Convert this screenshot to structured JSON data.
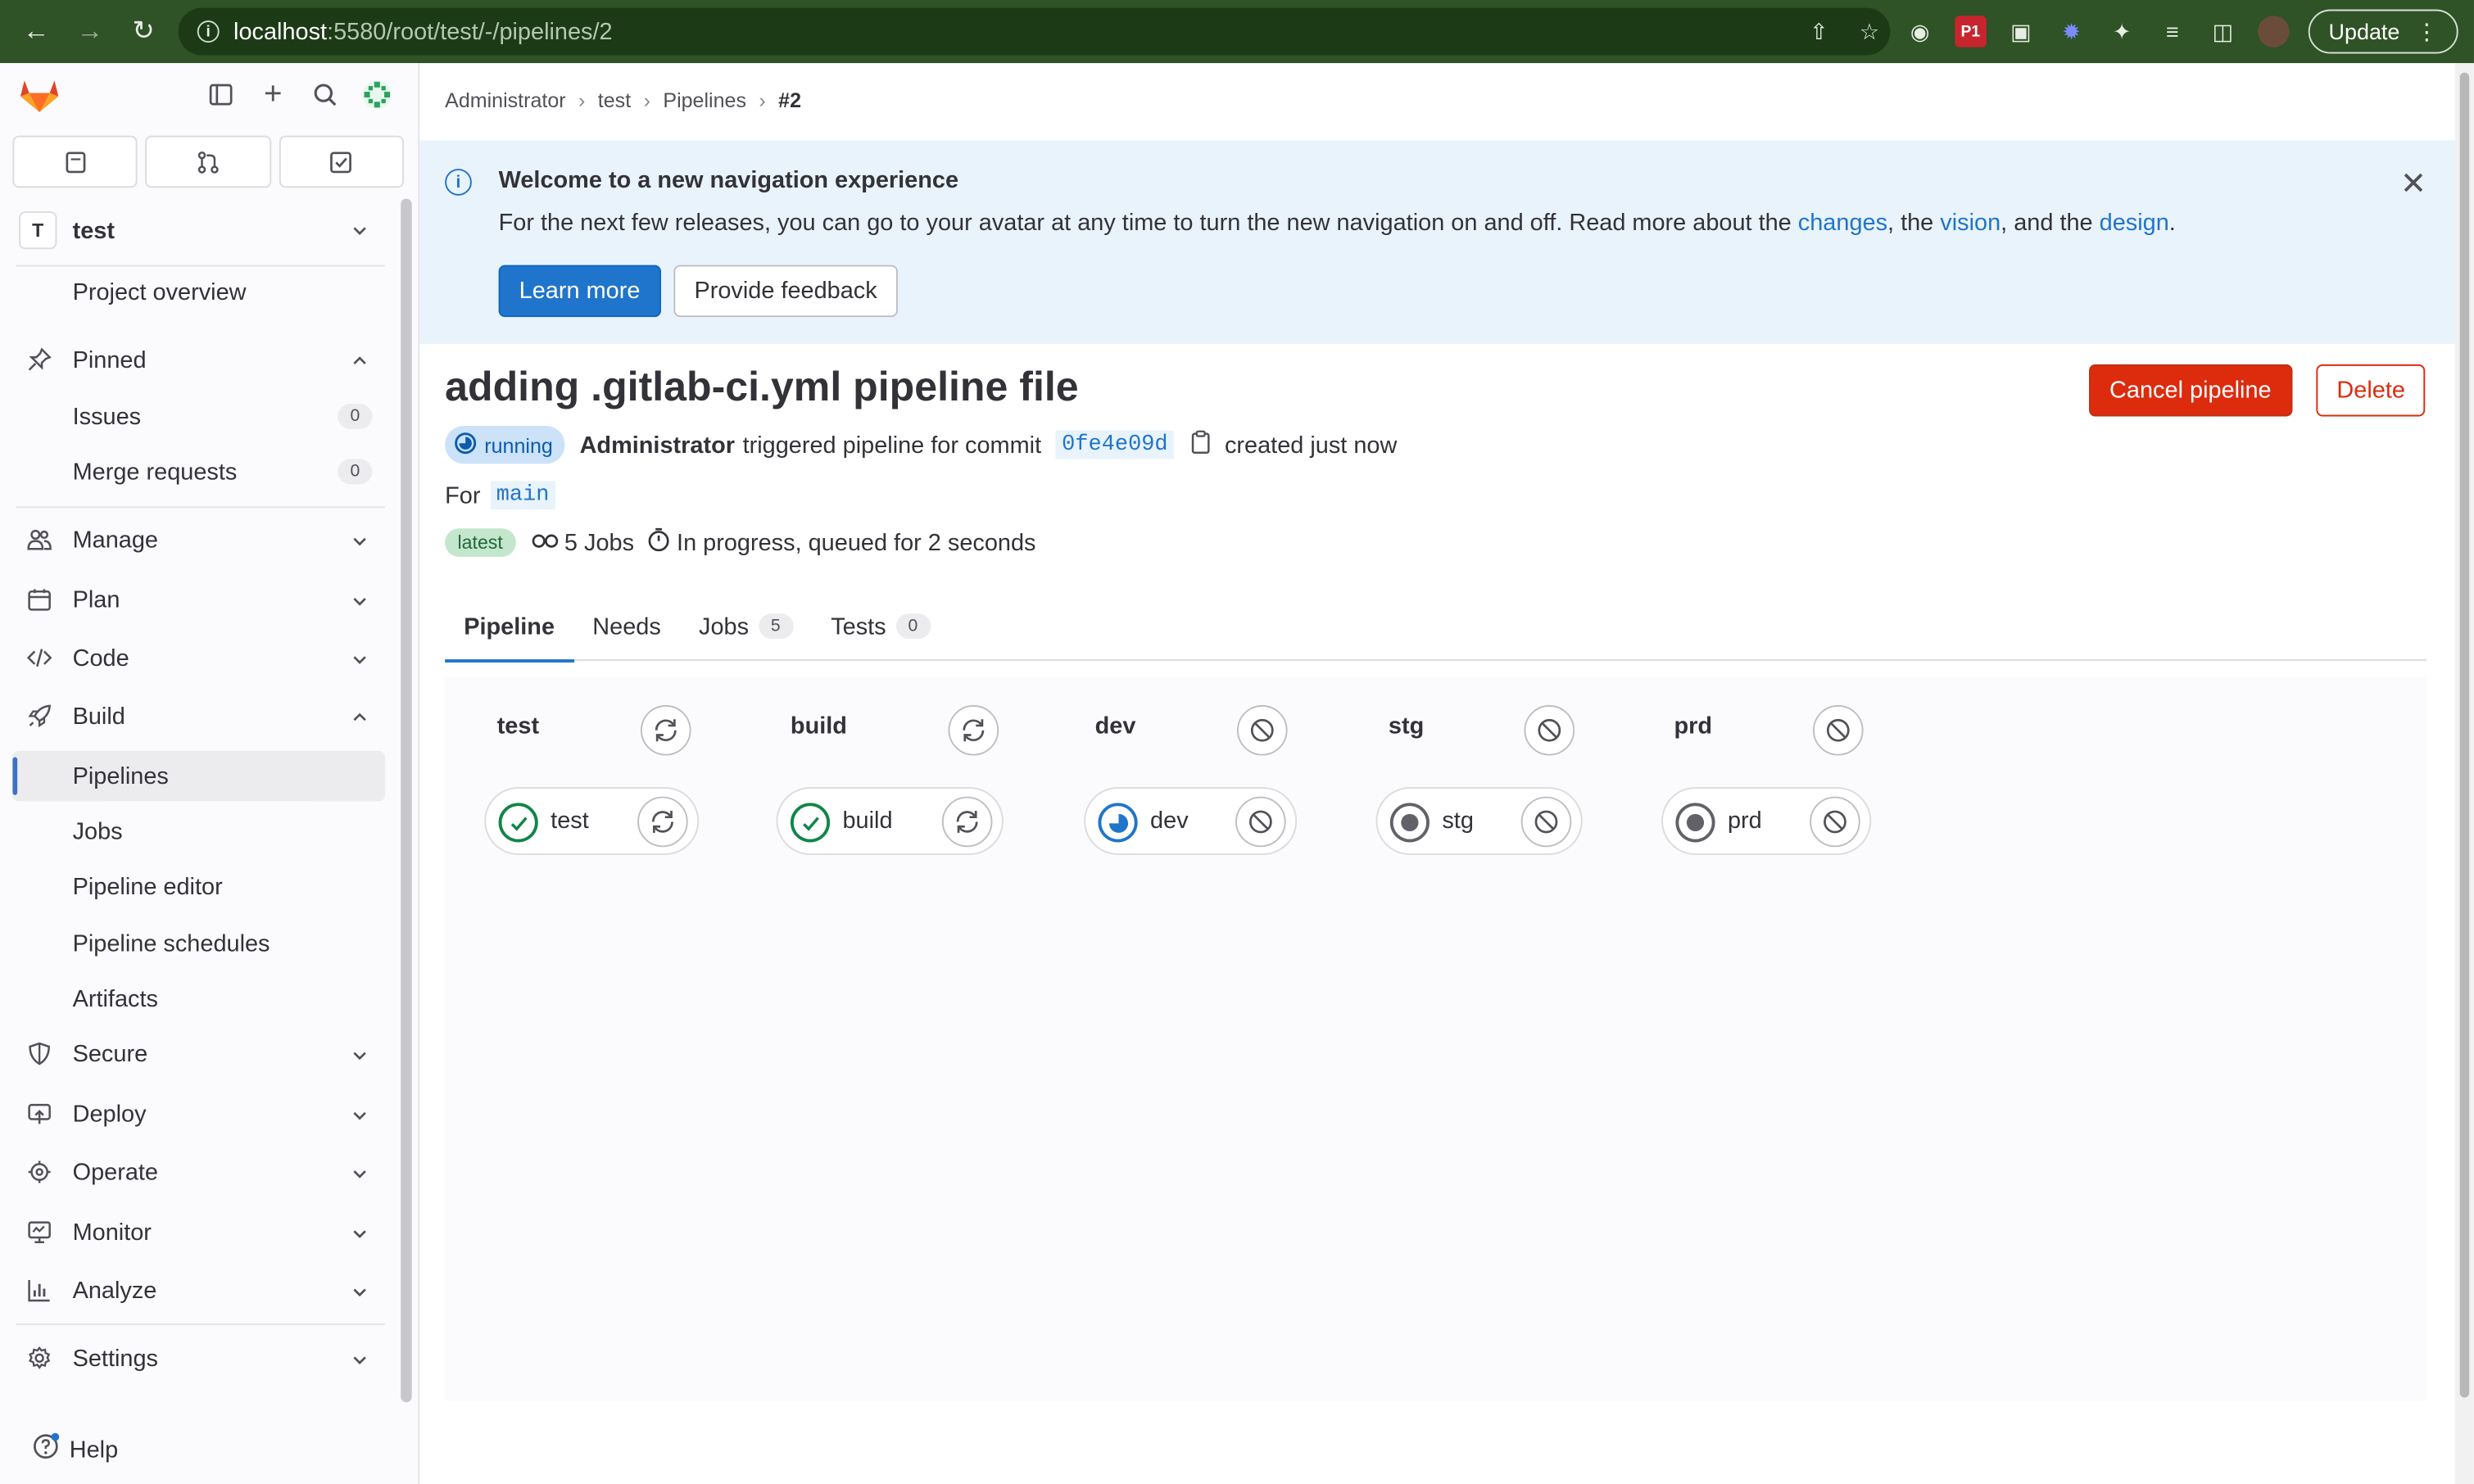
{
  "browser": {
    "url_host": "localhost",
    "url_path": ":5580/root/test/-/pipelines/2",
    "update_label": "Update"
  },
  "sidebar": {
    "project_initial": "T",
    "project_name": "test",
    "items": [
      {
        "label": "Project overview"
      },
      {
        "label": "Pinned"
      },
      {
        "label": "Issues",
        "count": "0"
      },
      {
        "label": "Merge requests",
        "count": "0"
      },
      {
        "label": "Manage"
      },
      {
        "label": "Plan"
      },
      {
        "label": "Code"
      },
      {
        "label": "Build"
      },
      {
        "label": "Pipelines"
      },
      {
        "label": "Jobs"
      },
      {
        "label": "Pipeline editor"
      },
      {
        "label": "Pipeline schedules"
      },
      {
        "label": "Artifacts"
      },
      {
        "label": "Secure"
      },
      {
        "label": "Deploy"
      },
      {
        "label": "Operate"
      },
      {
        "label": "Monitor"
      },
      {
        "label": "Analyze"
      },
      {
        "label": "Settings"
      }
    ],
    "help_label": "Help"
  },
  "breadcrumbs": [
    "Administrator",
    "test",
    "Pipelines",
    "#2"
  ],
  "banner": {
    "title": "Welcome to a new navigation experience",
    "body_prefix": "For the next few releases, you can go to your avatar at any time to turn the new navigation on and off. Read more about the ",
    "link_changes": "changes",
    "sep1": ", the ",
    "link_vision": "vision",
    "sep2": ", and the ",
    "link_design": "design",
    "suffix": ".",
    "learn_more": "Learn more",
    "feedback": "Provide feedback"
  },
  "pipeline": {
    "title": "adding .gitlab-ci.yml pipeline file",
    "cancel_label": "Cancel pipeline",
    "delete_label": "Delete",
    "status": "running",
    "user": "Administrator",
    "triggered_text": "triggered pipeline for commit",
    "sha": "0fe4e09d",
    "created": "created just now",
    "for_label": "For",
    "branch": "main",
    "latest_badge": "latest",
    "jobs_count": "5 Jobs",
    "progress_text": "In progress, queued for 2 seconds"
  },
  "tabs": [
    {
      "label": "Pipeline"
    },
    {
      "label": "Needs"
    },
    {
      "label": "Jobs",
      "count": "5"
    },
    {
      "label": "Tests",
      "count": "0"
    }
  ],
  "stages": [
    {
      "name": "test",
      "action": "retry",
      "job": {
        "name": "test",
        "status": "passed",
        "action": "retry"
      }
    },
    {
      "name": "build",
      "action": "retry",
      "job": {
        "name": "build",
        "status": "passed",
        "action": "retry"
      }
    },
    {
      "name": "dev",
      "action": "cancel",
      "job": {
        "name": "dev",
        "status": "running",
        "action": "cancel"
      }
    },
    {
      "name": "stg",
      "action": "cancel",
      "job": {
        "name": "stg",
        "status": "pending",
        "action": "cancel"
      }
    },
    {
      "name": "prd",
      "action": "cancel",
      "job": {
        "name": "prd",
        "status": "pending",
        "action": "cancel"
      }
    }
  ],
  "colors": {
    "chrome": "#2f5226",
    "primary": "#1f75cb",
    "danger": "#dd2b0e",
    "success": "#108548",
    "running": "#1f75cb",
    "pending": "#626168"
  }
}
